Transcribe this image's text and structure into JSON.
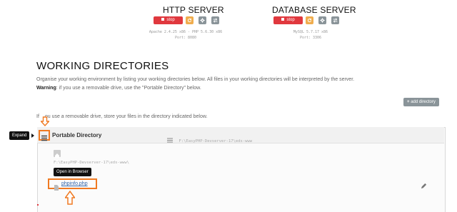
{
  "servers": {
    "http": {
      "title": "HTTP SERVER",
      "stop_label": "stop",
      "info_line1": "Apache 2.4.25 x86 - PHP 5.6.30 x86",
      "info_line2": "Port: 8080"
    },
    "database": {
      "title": "DATABASE SERVER",
      "stop_label": "stop",
      "info_line1": "MySQL 5.7.17 x86",
      "info_line2": "Port: 3306"
    }
  },
  "working_directories": {
    "title": "WORKING DIRECTORIES",
    "description": "Organise your working environment by listing your working directories below. All files in your working directories will be interpreted by the server.",
    "warning_label": "Warning",
    "warning_text": ": if you use a removable drive, use the \"Portable Directory\" below.",
    "add_button_label": "add directory",
    "removable_note_prefix": "If ",
    "removable_note": "ou use a removable drive, store your files in the directory indicated below."
  },
  "portable_directory": {
    "title": "Portable Directory",
    "path": "F:\\EasyPHP-Devserver-17\\eds-www",
    "current_path": "F:\\EasyPHP-Devserver-17\\eds-www\\",
    "file_name": "phpinfo.php"
  },
  "annotations": {
    "expand_tooltip": "Expand",
    "open_browser_tooltip": "Open in Browser"
  },
  "colors": {
    "stop": "#e0383e",
    "refresh": "#f0ad4e",
    "gray_button": "#8a9499",
    "annotation_orange": "#f07a22"
  }
}
